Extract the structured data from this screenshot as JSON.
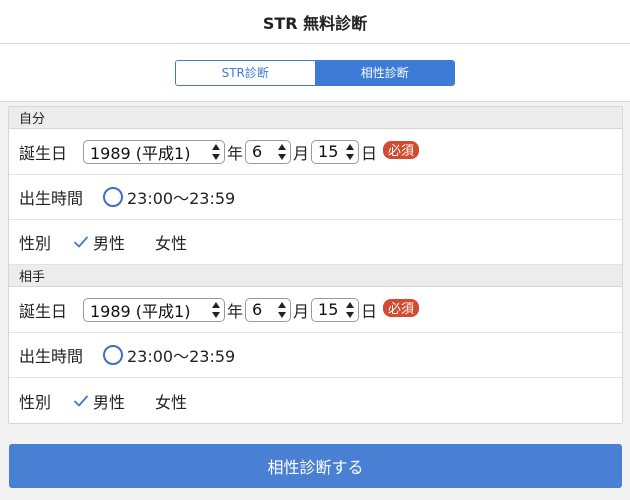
{
  "header": {
    "title": "STR 無料診断"
  },
  "tabs": [
    {
      "label": "STR診断",
      "active": false
    },
    {
      "label": "相性診断",
      "active": true
    }
  ],
  "self": {
    "section_label": "自分",
    "birth_label": "誕生日",
    "year": "1989 (平成1)",
    "year_unit": "年",
    "month": "6",
    "month_unit": "月",
    "day": "15",
    "day_unit": "日",
    "required_badge": "必須",
    "time_label": "出生時間",
    "time_range": "23:00〜23:59",
    "gender_label": "性別",
    "male": "男性",
    "female": "女性",
    "selected_gender": "男性"
  },
  "partner": {
    "section_label": "相手",
    "birth_label": "誕生日",
    "year": "1989 (平成1)",
    "year_unit": "年",
    "month": "6",
    "month_unit": "月",
    "day": "15",
    "day_unit": "日",
    "required_badge": "必須",
    "time_label": "出生時間",
    "time_range": "23:00〜23:59",
    "gender_label": "性別",
    "male": "男性",
    "female": "女性",
    "selected_gender": "男性"
  },
  "submit": {
    "label": "相性診断する"
  },
  "colors": {
    "accent": "#3d7bd6",
    "submit_bg": "#4a80d4",
    "required_bg": "#d34a30",
    "section_bg": "#ececec"
  }
}
